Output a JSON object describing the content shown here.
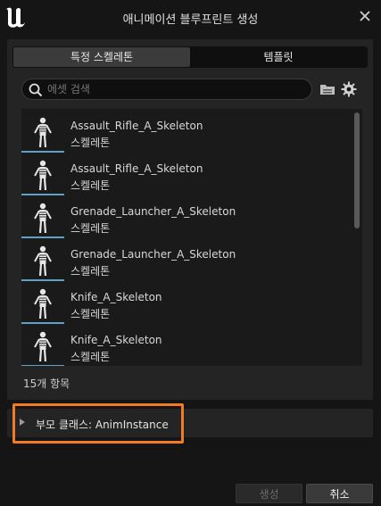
{
  "window": {
    "title": "애니메이션 블루프린트 생성"
  },
  "tabs": [
    {
      "label": "특정 스켈레톤",
      "active": true
    },
    {
      "label": "템플릿",
      "active": false
    }
  ],
  "search": {
    "placeholder": "에셋 검색",
    "value": ""
  },
  "assets": [
    {
      "name": "Assault_Rifle_A_Skeleton",
      "type": "스켈레톤"
    },
    {
      "name": "Assault_Rifle_A_Skeleton",
      "type": "스켈레톤"
    },
    {
      "name": "Grenade_Launcher_A_Skeleton",
      "type": "스켈레톤"
    },
    {
      "name": "Grenade_Launcher_A_Skeleton",
      "type": "스켈레톤"
    },
    {
      "name": "Knife_A_Skeleton",
      "type": "스켈레톤"
    },
    {
      "name": "Knife_A_Skeleton",
      "type": "스켈레톤"
    }
  ],
  "item_count": "15개 항목",
  "parent_class": "부모 클래스: AnimInstance",
  "buttons": {
    "create": "생성",
    "cancel": "취소"
  },
  "colors": {
    "highlight": "#f07c28",
    "thumb_accent": "#5fa0c8"
  }
}
